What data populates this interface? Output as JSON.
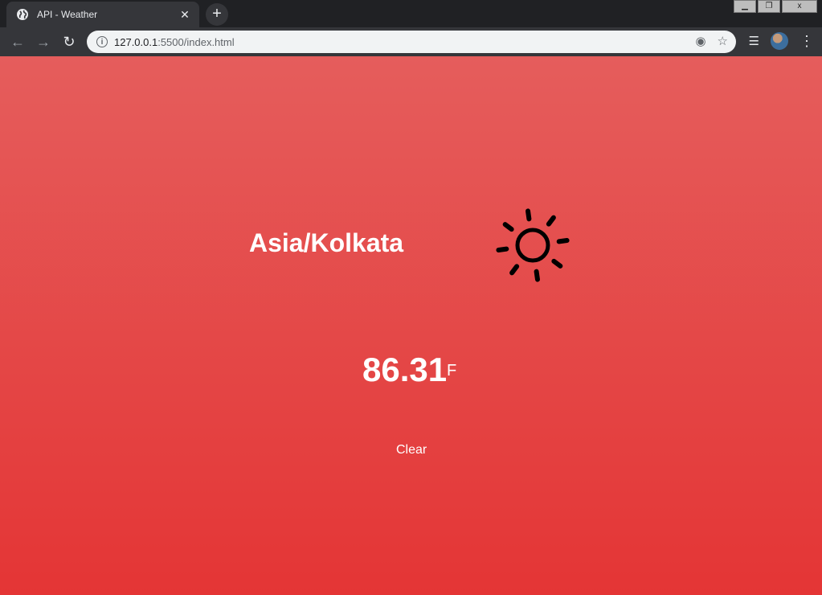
{
  "browser": {
    "tab_title": "API - Weather",
    "tab_close_glyph": "✕",
    "new_tab_glyph": "+",
    "url_host": "127.0.0.1",
    "url_path": ":5500/index.html",
    "window_controls": [
      "▁",
      "❐",
      "x"
    ]
  },
  "weather": {
    "timezone": "Asia/Kolkata",
    "temperature": "86.31",
    "unit": "F",
    "summary": "Clear",
    "icon": "sun-icon"
  },
  "colors": {
    "gradient_top": "#e55d5c",
    "gradient_bottom": "#e43535",
    "text": "#ffffff"
  }
}
